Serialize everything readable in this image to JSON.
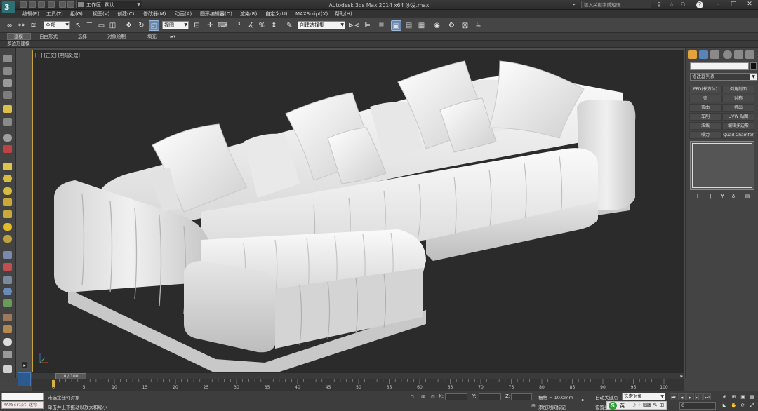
{
  "titlebar": {
    "logo": "3",
    "workspace_label": "工作区: 默认",
    "app_title": "Autodesk 3ds Max  2014 x64     沙发.max",
    "search_placeholder": "键入关键字或短语",
    "icons": [
      "binoculars-icon",
      "star-icon",
      "user-icon",
      "help-icon"
    ],
    "window_controls": [
      "minimize",
      "maximize",
      "close"
    ]
  },
  "menu": {
    "items": [
      "编辑(E)",
      "工具(T)",
      "组(G)",
      "视图(V)",
      "创建(C)",
      "修改器(M)",
      "动画(A)",
      "图形编辑器(D)",
      "渲染(R)",
      "自定义(U)",
      "MAXScript(X)",
      "帮助(H)"
    ]
  },
  "toolbar": {
    "selection_filter": "全部",
    "reference_coord": "视图",
    "named_selection": "创建选择集"
  },
  "ribbon": {
    "tabs": [
      "建模",
      "自由形式",
      "选择",
      "对象绘制",
      "填充"
    ],
    "subtitle": "多边形建模"
  },
  "viewport": {
    "label": "[+] [正交] [明暗处理]"
  },
  "command_panel": {
    "modifier_list_label": "修改器列表",
    "modifier_buttons": [
      "FFD(长方体)",
      "倒角剖面",
      "壳",
      "对称",
      "弯曲",
      "挤出",
      "车削",
      "UVW 贴图",
      "法线",
      "编辑多边形",
      "噪力",
      "Quad Chamfer"
    ]
  },
  "timeline": {
    "frame_display": "0 / 100",
    "ticks": [
      "0",
      "5",
      "10",
      "15",
      "20",
      "25",
      "30",
      "35",
      "40",
      "45",
      "50",
      "55",
      "60",
      "65",
      "70",
      "75",
      "80",
      "85",
      "90",
      "95",
      "100"
    ]
  },
  "status": {
    "maxscript_label": "MAXScript 迷你",
    "line1": "未选定任何对象",
    "line2": "单击并上下拖动以放大和缩小",
    "x_label": "X:",
    "y_label": "Y:",
    "z_label": "Z:",
    "grid_label": "栅格 = 10.0mm",
    "add_time_tag": "添加时间标记",
    "autokey_label": "自动关键点",
    "setkey_label": "设置关键点",
    "autokey_select": "选定对象",
    "ime_text": "英",
    "frame_value": "0"
  },
  "colors": {
    "viewport_border": "#c9a43a",
    "viewport_bg": "#2b2b2b",
    "active_tool": "#6a89b0"
  }
}
